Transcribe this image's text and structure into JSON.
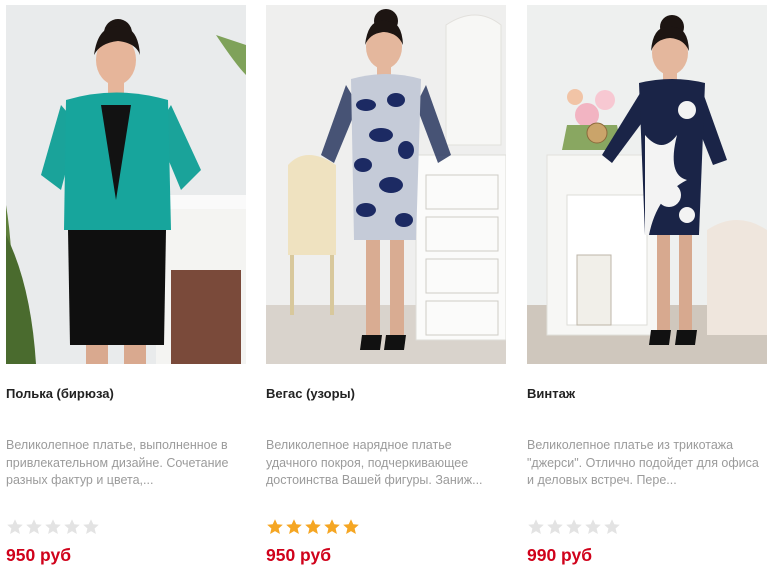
{
  "products": [
    {
      "title": "Полька (бирюза)",
      "description": "Великолепное платье, выполненное в привлекательном дизайне. Сочетание разных фактур и цвета,...",
      "rating": 0,
      "price": "950 руб",
      "image_icon": "dress-photo"
    },
    {
      "title": "Вегас (узоры)",
      "description": "Великолепное нарядное платье удачного покроя, подчеркивающее достоинства Вашей фигуры. Заниж...",
      "rating": 5,
      "price": "950 руб",
      "image_icon": "dress-photo"
    },
    {
      "title": "Винтаж",
      "description": "Великолепное платье из трикотажа \"джерси\". Отлично подойдет для офиса и деловых встреч. Пере...",
      "rating": 0,
      "price": "990 руб",
      "image_icon": "dress-photo"
    }
  ],
  "colors": {
    "price": "#d0021b",
    "star_filled": "#f5a623",
    "star_empty": "#e3e3e3",
    "title": "#222222",
    "description": "#9b9b9b"
  }
}
